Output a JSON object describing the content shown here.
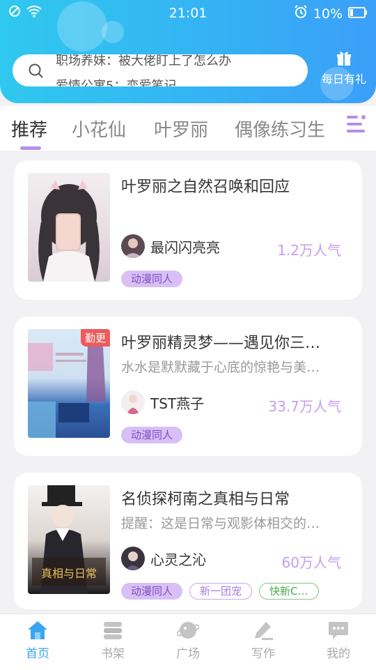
{
  "status": {
    "time": "21:01",
    "battery": "10%"
  },
  "search": {
    "ticker_line1": "职场养妹：被大佬盯上了怎么办",
    "ticker_line2": "爱情公寓5：恋爱笔记"
  },
  "gift": {
    "label": "每日有礼"
  },
  "tabs": [
    {
      "label": "推荐"
    },
    {
      "label": "小花仙"
    },
    {
      "label": "叶罗丽"
    },
    {
      "label": "偶像练习生"
    }
  ],
  "cards": [
    {
      "title": "叶罗丽之自然召唤和回应",
      "desc": "",
      "author": "最闪闪亮亮",
      "popularity": "1.2万人气",
      "tags": [
        "动漫同人"
      ]
    },
    {
      "title": "叶罗丽精灵梦——遇见你三…",
      "desc": "水水是默默藏于心底的惊艳与美…",
      "author": "TST燕子",
      "popularity": "33.7万人气",
      "badge": "勤更",
      "tags": [
        "动漫同人"
      ]
    },
    {
      "title": "名侦探柯南之真相与日常",
      "desc": "提醒：这是日常与观影体相交的…",
      "author": "心灵之沁",
      "popularity": "60万人气",
      "tags": [
        "动漫同人",
        "新一团宠",
        "快新C…"
      ]
    }
  ],
  "nav": [
    {
      "label": "首页",
      "icon": "home-icon"
    },
    {
      "label": "书架",
      "icon": "bookshelf-icon"
    },
    {
      "label": "广场",
      "icon": "plaza-icon"
    },
    {
      "label": "写作",
      "icon": "write-icon"
    },
    {
      "label": "我的",
      "icon": "profile-icon"
    }
  ],
  "colors": {
    "accent": "#3aa6f0",
    "purple": "#c69df0"
  }
}
